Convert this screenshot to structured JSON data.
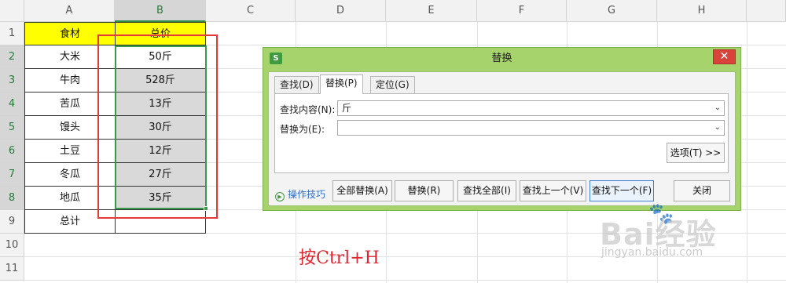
{
  "spreadsheet": {
    "columns": [
      "A",
      "B",
      "C",
      "D",
      "E",
      "F",
      "G",
      "H"
    ],
    "rows": [
      "1",
      "2",
      "3",
      "4",
      "5",
      "6",
      "7",
      "8",
      "9",
      "10",
      "11"
    ],
    "header": {
      "a1": "食材",
      "b1": "总价"
    },
    "data": [
      {
        "a": "大米",
        "b": "50斤"
      },
      {
        "a": "牛肉",
        "b": "528斤"
      },
      {
        "a": "苦瓜",
        "b": "13斤"
      },
      {
        "a": "馒头",
        "b": "30斤"
      },
      {
        "a": "土豆",
        "b": "12斤"
      },
      {
        "a": "冬瓜",
        "b": "27斤"
      },
      {
        "a": "地瓜",
        "b": "35斤"
      }
    ],
    "total_label": "总计"
  },
  "dialog": {
    "title": "替换",
    "app_icon": "S",
    "close_icon": "close-icon",
    "tabs": [
      "查找(D)",
      "替换(P)",
      "定位(G)"
    ],
    "active_tab": "替换(P)",
    "find_label": "查找内容(N):",
    "find_value": "斤",
    "replace_label": "替换为(E):",
    "replace_value": "",
    "options_button": "选项(T) >>",
    "tips_label": "操作技巧",
    "buttons": {
      "replace_all": "全部替换(A)",
      "replace": "替换(R)",
      "find_all": "查找全部(I)",
      "find_prev": "查找上一个(V)",
      "find_next": "查找下一个(F)",
      "close": "关闭"
    }
  },
  "annotation": "按Ctrl+H",
  "watermark": {
    "brand": "Bai经验",
    "url": "jingyan.baidu.com"
  },
  "colors": {
    "header_fill": "#ffff00",
    "dialog_frame": "#a6d36b",
    "highlight_box": "#e53935",
    "selection": "#3a9a4c",
    "annotation": "#e0262e"
  }
}
